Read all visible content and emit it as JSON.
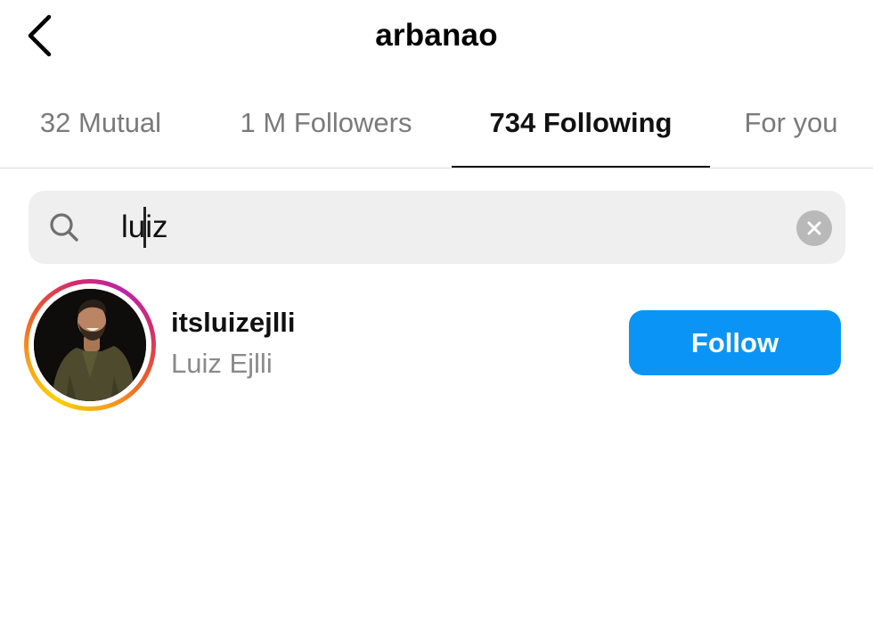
{
  "header": {
    "title": "arbanao",
    "back_icon": "chevron-left-icon"
  },
  "tabs": [
    {
      "label": "32 Mutual",
      "active": false
    },
    {
      "label": "1 M Followers",
      "active": false
    },
    {
      "label": "734 Following",
      "active": true
    },
    {
      "label": "For you",
      "active": false
    }
  ],
  "search": {
    "icon": "search-icon",
    "value": "luiz",
    "clear_icon": "clear-icon"
  },
  "results": [
    {
      "username": "itsluizejlli",
      "full_name": "Luiz Ejlli",
      "button_label": "Follow",
      "has_story_ring": true
    }
  ],
  "colors": {
    "follow_button": "#0a95f6",
    "inactive_tab": "#7a7a7a",
    "search_background": "#efefef"
  }
}
